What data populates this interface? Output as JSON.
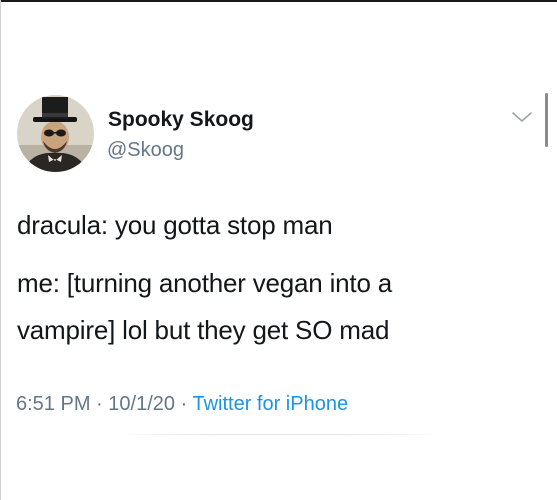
{
  "tweet": {
    "author": {
      "display_name": "Spooky Skoog",
      "handle": "@Skoog",
      "avatar_icon": "profile-photo-top-hat"
    },
    "menu_icon": "chevron-down-icon",
    "text_lines": [
      "dracula: you gotta stop man",
      "me: [turning another vegan into a",
      "vampire] lol but they get SO mad"
    ],
    "meta": {
      "time": "6:51 PM",
      "separator": "·",
      "date": "10/1/20",
      "source": "Twitter for iPhone"
    }
  },
  "colors": {
    "text": "#14171a",
    "secondary": "#657786",
    "link": "#1b95e0"
  }
}
